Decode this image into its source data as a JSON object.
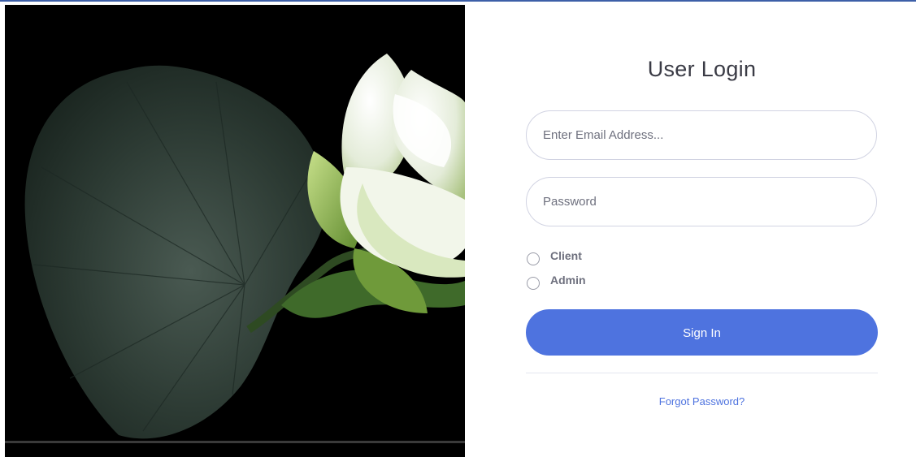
{
  "login": {
    "title": "User Login",
    "email_placeholder": "Enter Email Address...",
    "password_placeholder": "Password",
    "roles": [
      {
        "label": "Client",
        "selected": false
      },
      {
        "label": "Admin",
        "selected": false
      }
    ],
    "signin_label": "Sign In",
    "forgot_label": "Forgot Password?"
  },
  "colors": {
    "accent": "#4e73df",
    "text": "#3a3b45",
    "muted_text": "#6e707e",
    "border": "#d1d3e2",
    "image_background": "#000000"
  }
}
